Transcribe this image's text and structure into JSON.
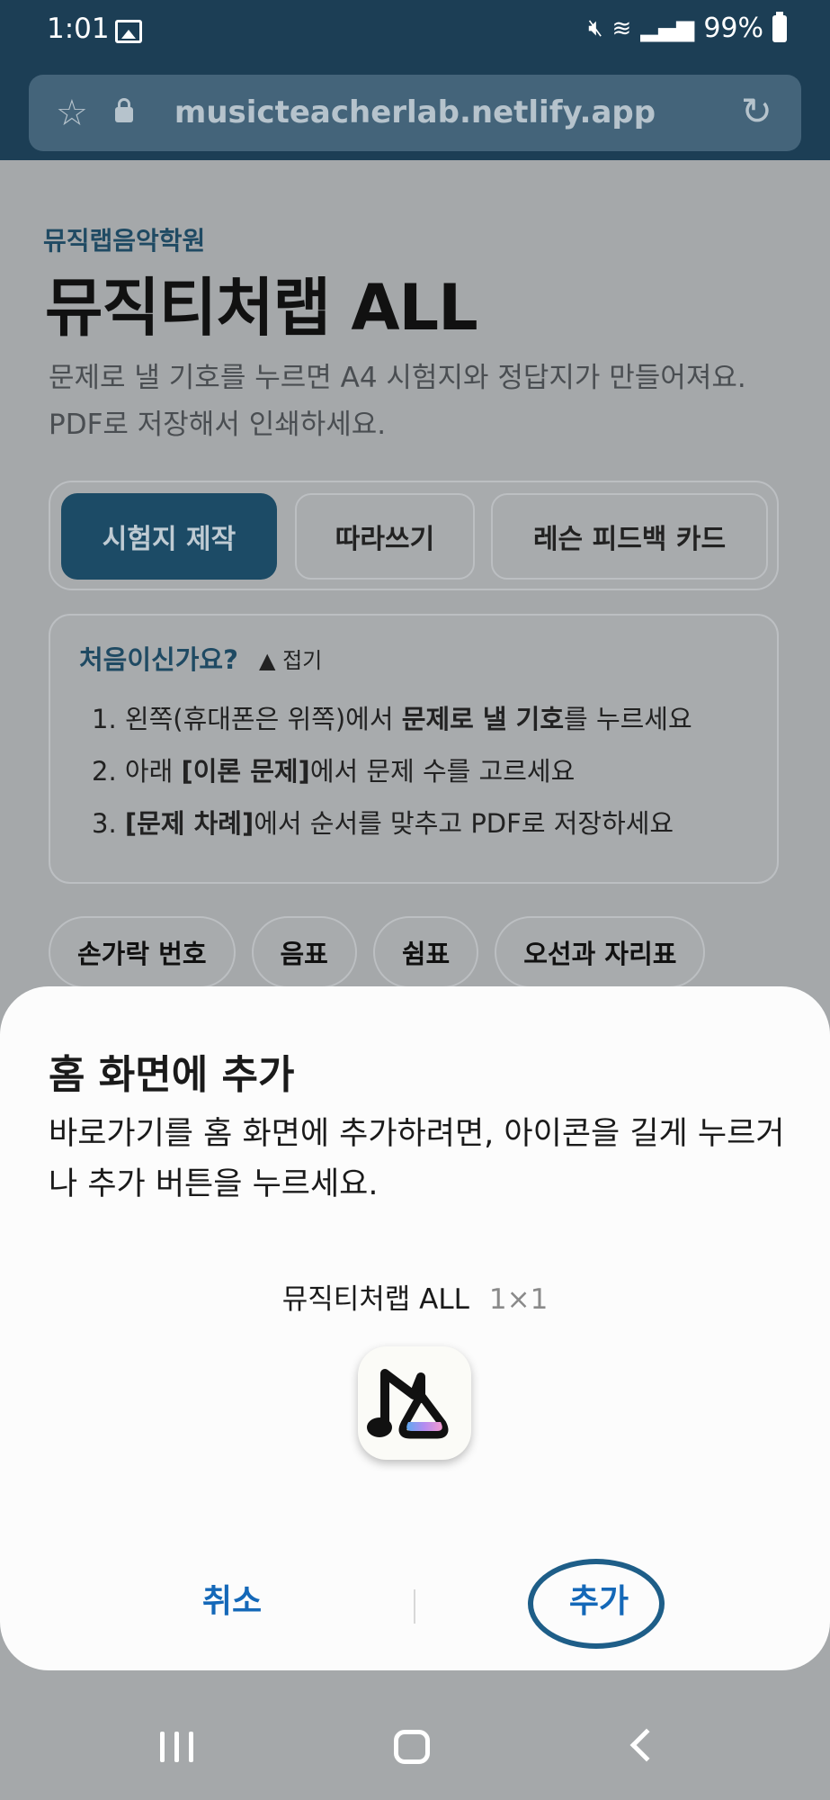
{
  "status": {
    "time": "1:01",
    "battery": "99%"
  },
  "browser": {
    "url": "musicteacherlab.netlify.app"
  },
  "page": {
    "academy": "뮤직랩음악학원",
    "title": "뮤직티처랩 ALL",
    "description": "문제로 낼 기호를 누르면 A4 시험지와 정답지가 만들어져요. PDF로 저장해서 인쇄하세요.",
    "tabs": [
      {
        "label": "시험지 제작",
        "active": true
      },
      {
        "label": "따라쓰기",
        "active": false
      },
      {
        "label": "레슨 피드백 카드",
        "active": false
      }
    ],
    "howto": {
      "heading": "처음이신가요?",
      "fold": "▲ 접기",
      "steps": [
        {
          "num": "1.",
          "pre": "왼쪽(휴대폰은 위쪽)에서 ",
          "bold": "문제로 낼 기호",
          "post": "를 누르세요"
        },
        {
          "num": "2.",
          "pre": "아래 ",
          "bold": "[이론 문제]",
          "post": "에서 문제 수를 고르세요"
        },
        {
          "num": "3.",
          "pre": "",
          "bold": "[문제 차례]",
          "post": "에서 순서를 맞추고 PDF로 저장하세요"
        }
      ]
    },
    "chips": [
      "손가락 번호",
      "음표",
      "쉼표",
      "오선과 자리표"
    ]
  },
  "dialog": {
    "title": "홈 화면에 추가",
    "description": "바로가기를 홈 화면에 추가하려면, 아이콘을 길게 누르거나 추가 버튼을 누르세요.",
    "shortcut_name": "뮤직티처랩 ALL",
    "shortcut_size": "1×1",
    "cancel_label": "취소",
    "add_label": "추가",
    "accent_color": "#1468b8"
  },
  "icons": [
    "star-icon",
    "lock-icon",
    "reload-icon",
    "image-icon",
    "mute-icon",
    "wifi-icon",
    "signal-icon",
    "battery-icon",
    "recents-icon",
    "home-icon",
    "back-icon"
  ]
}
